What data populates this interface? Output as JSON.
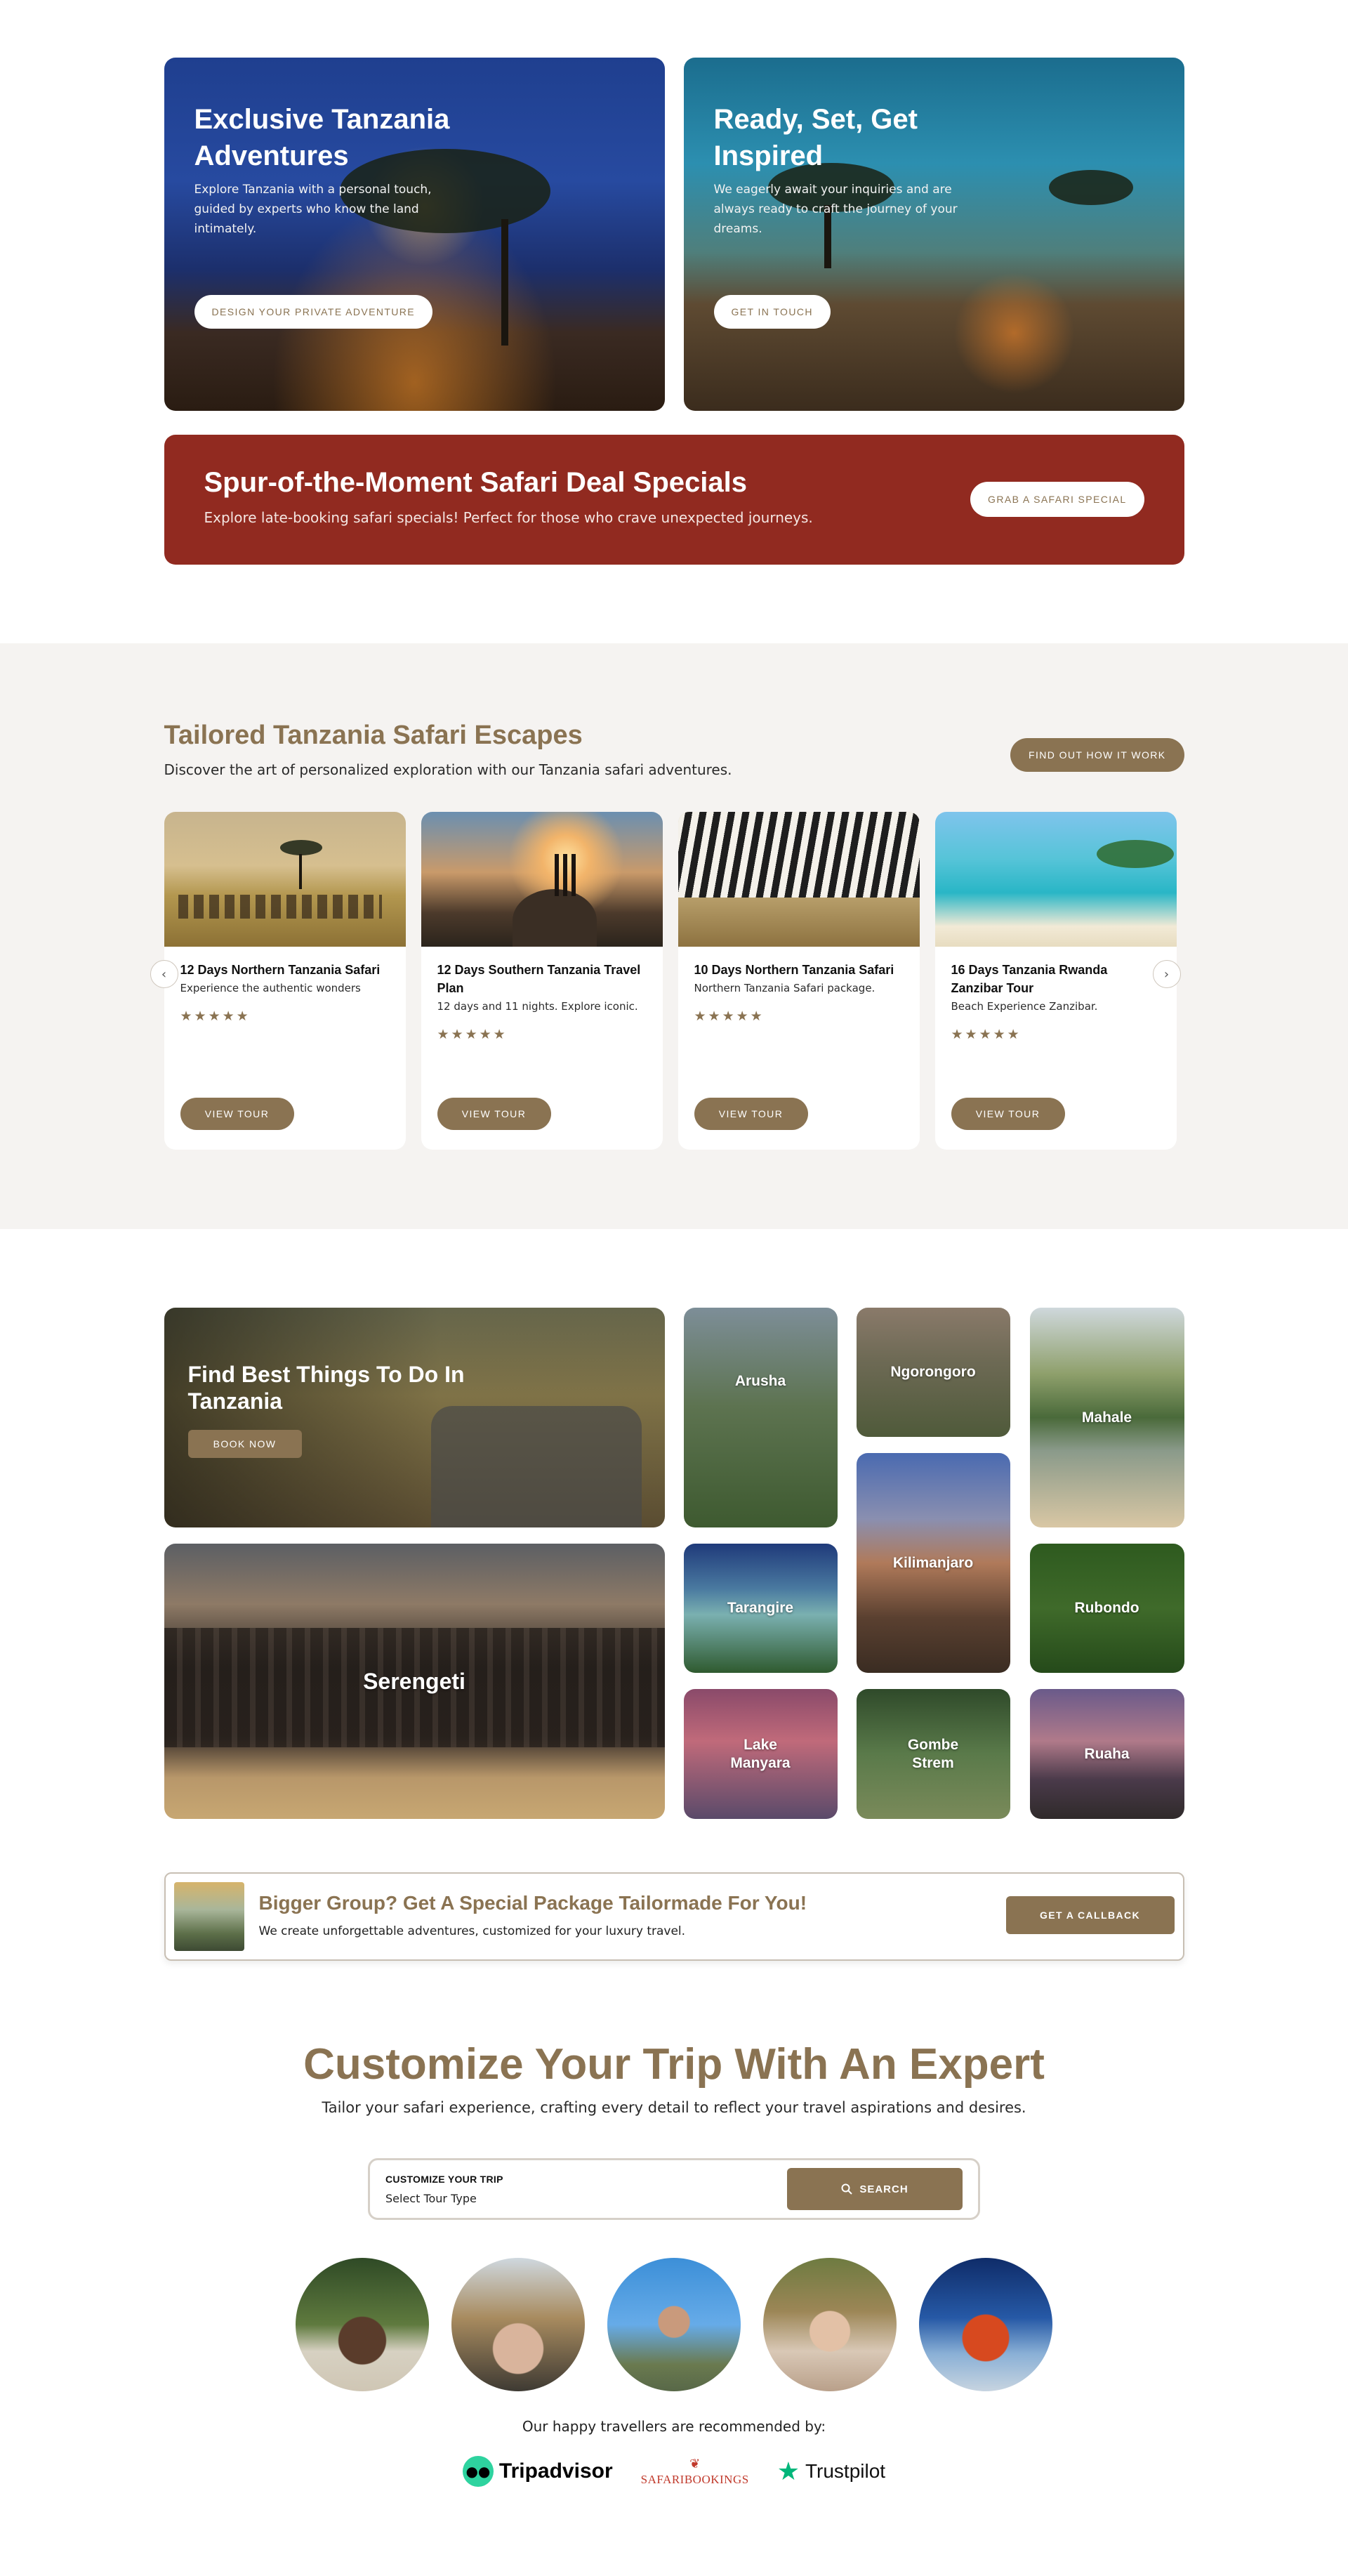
{
  "hero": {
    "cards": [
      {
        "title": "Exclusive Tanzania Adventures",
        "description": "Explore Tanzania with a personal touch, guided by experts who know the land intimately.",
        "button": "DESIGN YOUR PRIVATE ADVENTURE"
      },
      {
        "title": "Ready, Set, Get Inspired",
        "description": "We eagerly await your inquiries and are always ready to craft the journey of your dreams.",
        "button": "GET IN TOUCH"
      }
    ]
  },
  "deal": {
    "title": "Spur-of-the-Moment Safari Deal Specials",
    "description": "Explore late-booking safari specials! Perfect for those who crave unexpected journeys.",
    "button": "GRAB A SAFARI SPECIAL"
  },
  "tours": {
    "title": "Tailored Tanzania Safari Escapes",
    "subtitle": "Discover the art of personalized exploration with our Tanzania safari adventures.",
    "button": "FIND OUT HOW IT WORK",
    "prev_arrow": "‹",
    "next_arrow": "›",
    "items": [
      {
        "name": "12 Days Northern Tanzania Safari",
        "desc": "Experience the authentic wonders",
        "stars": "★★★★★",
        "button": "VIEW TOUR"
      },
      {
        "name": "12 Days Southern Tanzania Travel Plan",
        "desc": "12 days and 11 nights. Explore iconic.",
        "stars": "★★★★★",
        "button": "VIEW TOUR"
      },
      {
        "name": "10 Days Northern Tanzania Safari",
        "desc": "Northern Tanzania Safari package.",
        "stars": "★★★★★",
        "button": "VIEW TOUR"
      },
      {
        "name": "16 Days Tanzania Rwanda Zanzibar Tour",
        "desc": "Beach Experience Zanzibar.",
        "stars": "★★★★★",
        "button": "VIEW TOUR"
      }
    ]
  },
  "destinations": {
    "featured": {
      "title": "Find Best Things To Do In Tanzania",
      "button": "BOOK NOW"
    },
    "serengeti": "Serengeti",
    "arusha": "Arusha",
    "ngorongoro": "Ngorongoro",
    "mahale": "Mahale",
    "kilimanjaro": "Kilimanjaro",
    "tarangire": "Tarangire",
    "rubondo": "Rubondo",
    "lake_manyara": "Lake Manyara",
    "gombe": "Gombe Strem",
    "ruaha": "Ruaha"
  },
  "group": {
    "title": "Bigger Group? Get A Special Package Tailormade For You!",
    "description": "We create unforgettable adventures, customized for your luxury travel.",
    "button": "GET A CALLBACK"
  },
  "customize": {
    "title": "Customize Your Trip With An Expert",
    "subtitle": "Tailor your safari experience, crafting every detail to reflect your travel aspirations and desires.",
    "label": "CUSTOMIZE YOUR TRIP",
    "select_value": "Select Tour Type",
    "search_button": "SEARCH",
    "recommended": "Our happy travellers are recommended by:",
    "logos": {
      "tripadvisor": "Tripadvisor",
      "safaribookings": "SAFARIBOOKINGS",
      "trustpilot": "Trustpilot"
    }
  },
  "colors": {
    "brand": "#8a7352",
    "deal_red": "#912a20",
    "section_bg": "#f5f3f1"
  }
}
